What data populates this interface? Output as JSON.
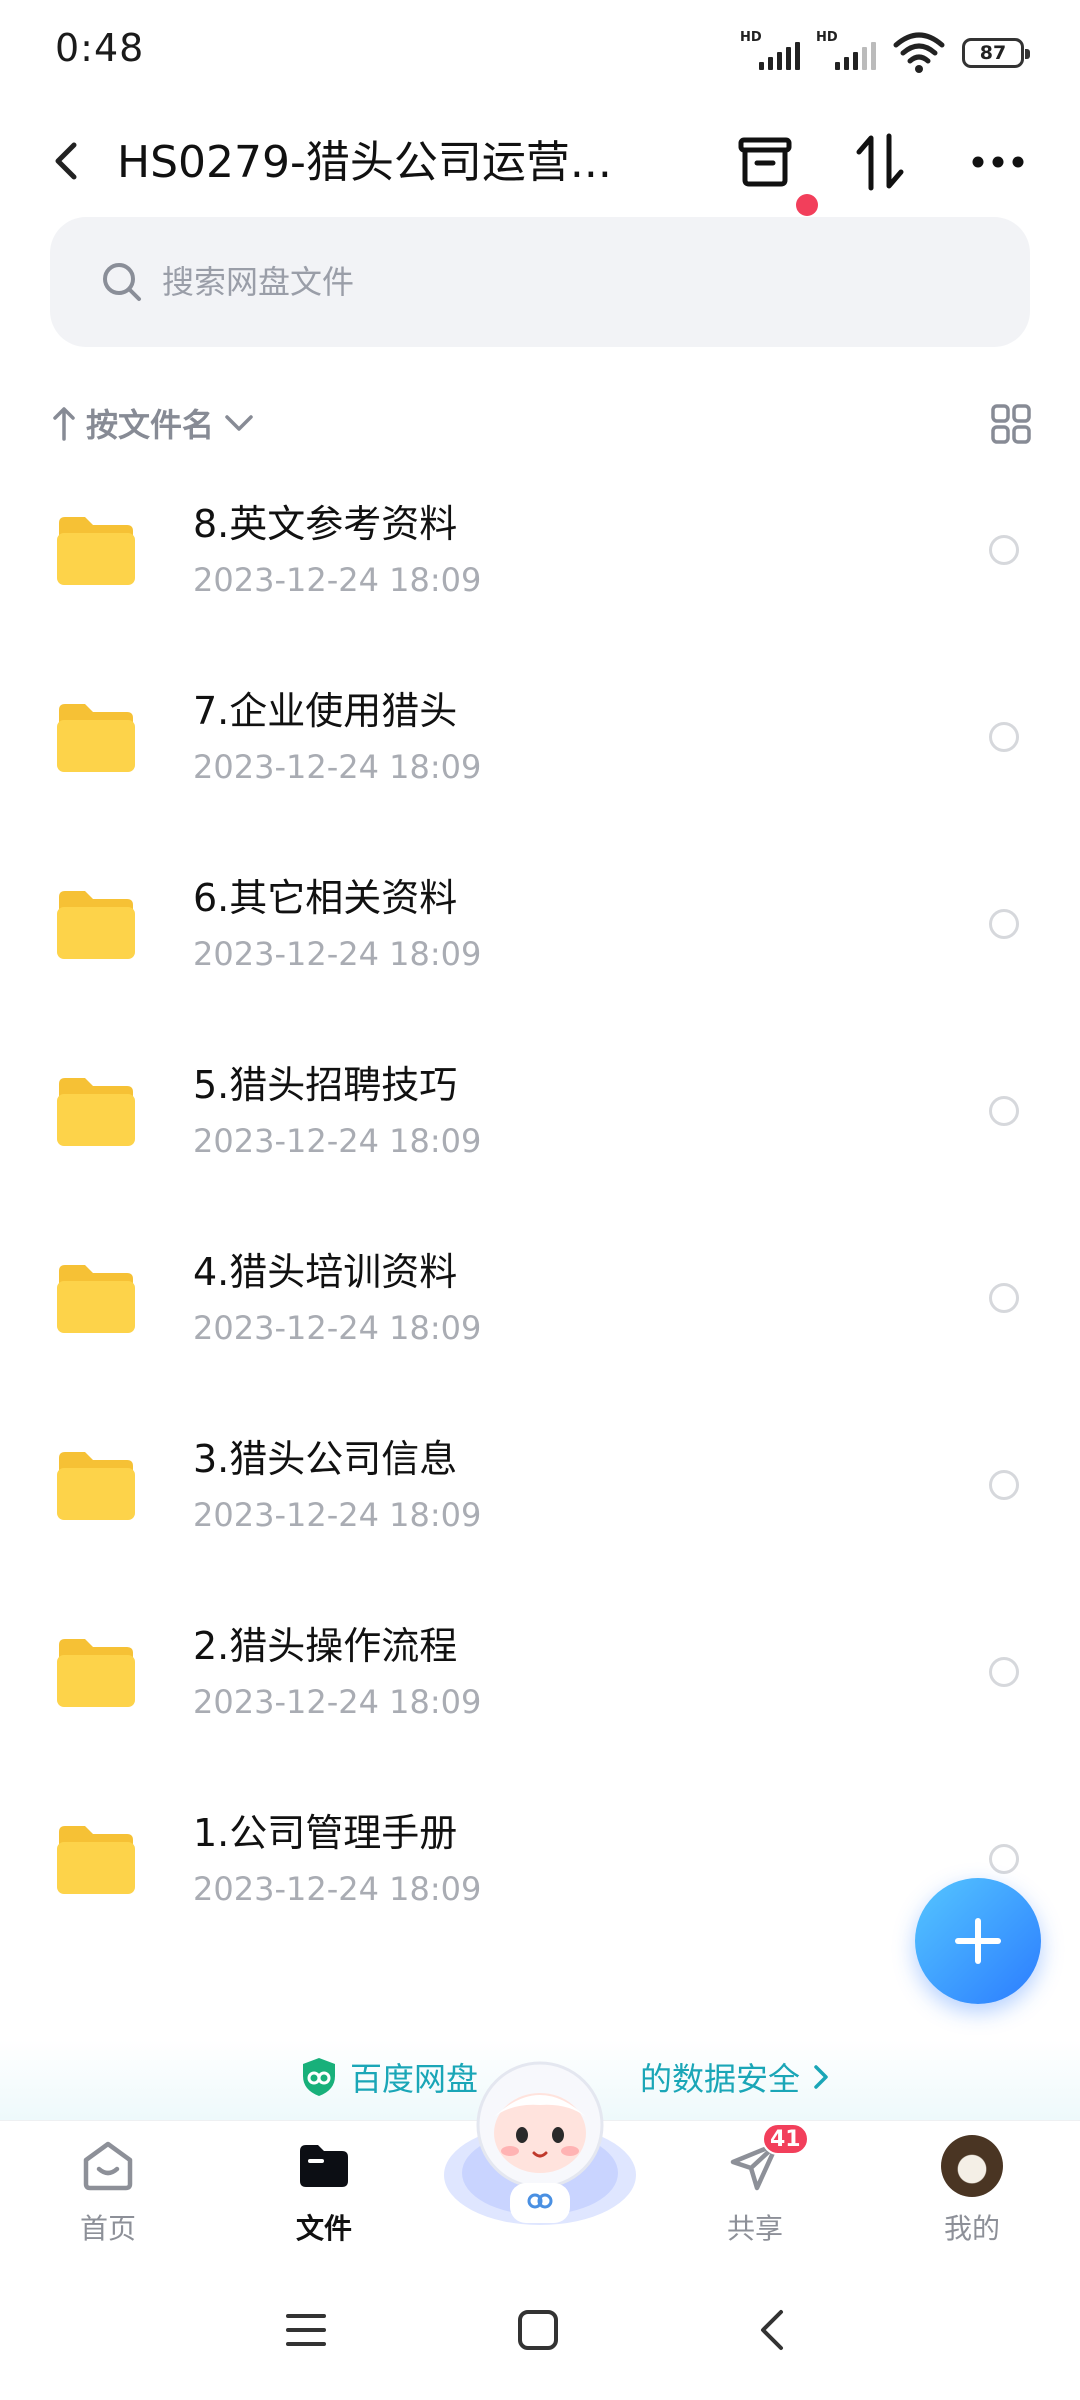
{
  "status_bar": {
    "time": "0:48",
    "signal1_label": "HD",
    "signal2_label": "HD",
    "battery": "87"
  },
  "header": {
    "title": "HS0279-猎头公司运营...",
    "icons": [
      "back-icon",
      "recycle-bin-icon",
      "transfer-icon",
      "more-icon"
    ],
    "notification_dot_color": "#f23f5b"
  },
  "search": {
    "placeholder": "搜索网盘文件"
  },
  "sort": {
    "label": "按文件名",
    "direction": "ascending"
  },
  "files": [
    {
      "name": "8.英文参考资料",
      "date": "2023-12-24  18:09"
    },
    {
      "name": "7.企业使用猎头",
      "date": "2023-12-24  18:09"
    },
    {
      "name": "6.其它相关资料",
      "date": "2023-12-24  18:09"
    },
    {
      "name": "5.猎头招聘技巧",
      "date": "2023-12-24  18:09"
    },
    {
      "name": "4.猎头培训资料",
      "date": "2023-12-24  18:09"
    },
    {
      "name": "3.猎头公司信息",
      "date": "2023-12-24  18:09"
    },
    {
      "name": "2.猎头操作流程",
      "date": "2023-12-24  18:09"
    },
    {
      "name": "1.公司管理手册",
      "date": "2023-12-24  18:09"
    }
  ],
  "banner": {
    "text_left": "百度网盘",
    "text_right": "的数据安全",
    "color": "#1aa6b7"
  },
  "bottom_nav": {
    "home_label": "首页",
    "files_label": "文件",
    "share_label": "共享",
    "share_badge": "41",
    "me_label": "我的",
    "active": "文件"
  },
  "colors": {
    "accent": "#2b7cff",
    "folder": "#fdd34a",
    "badge": "#f23f5b"
  }
}
